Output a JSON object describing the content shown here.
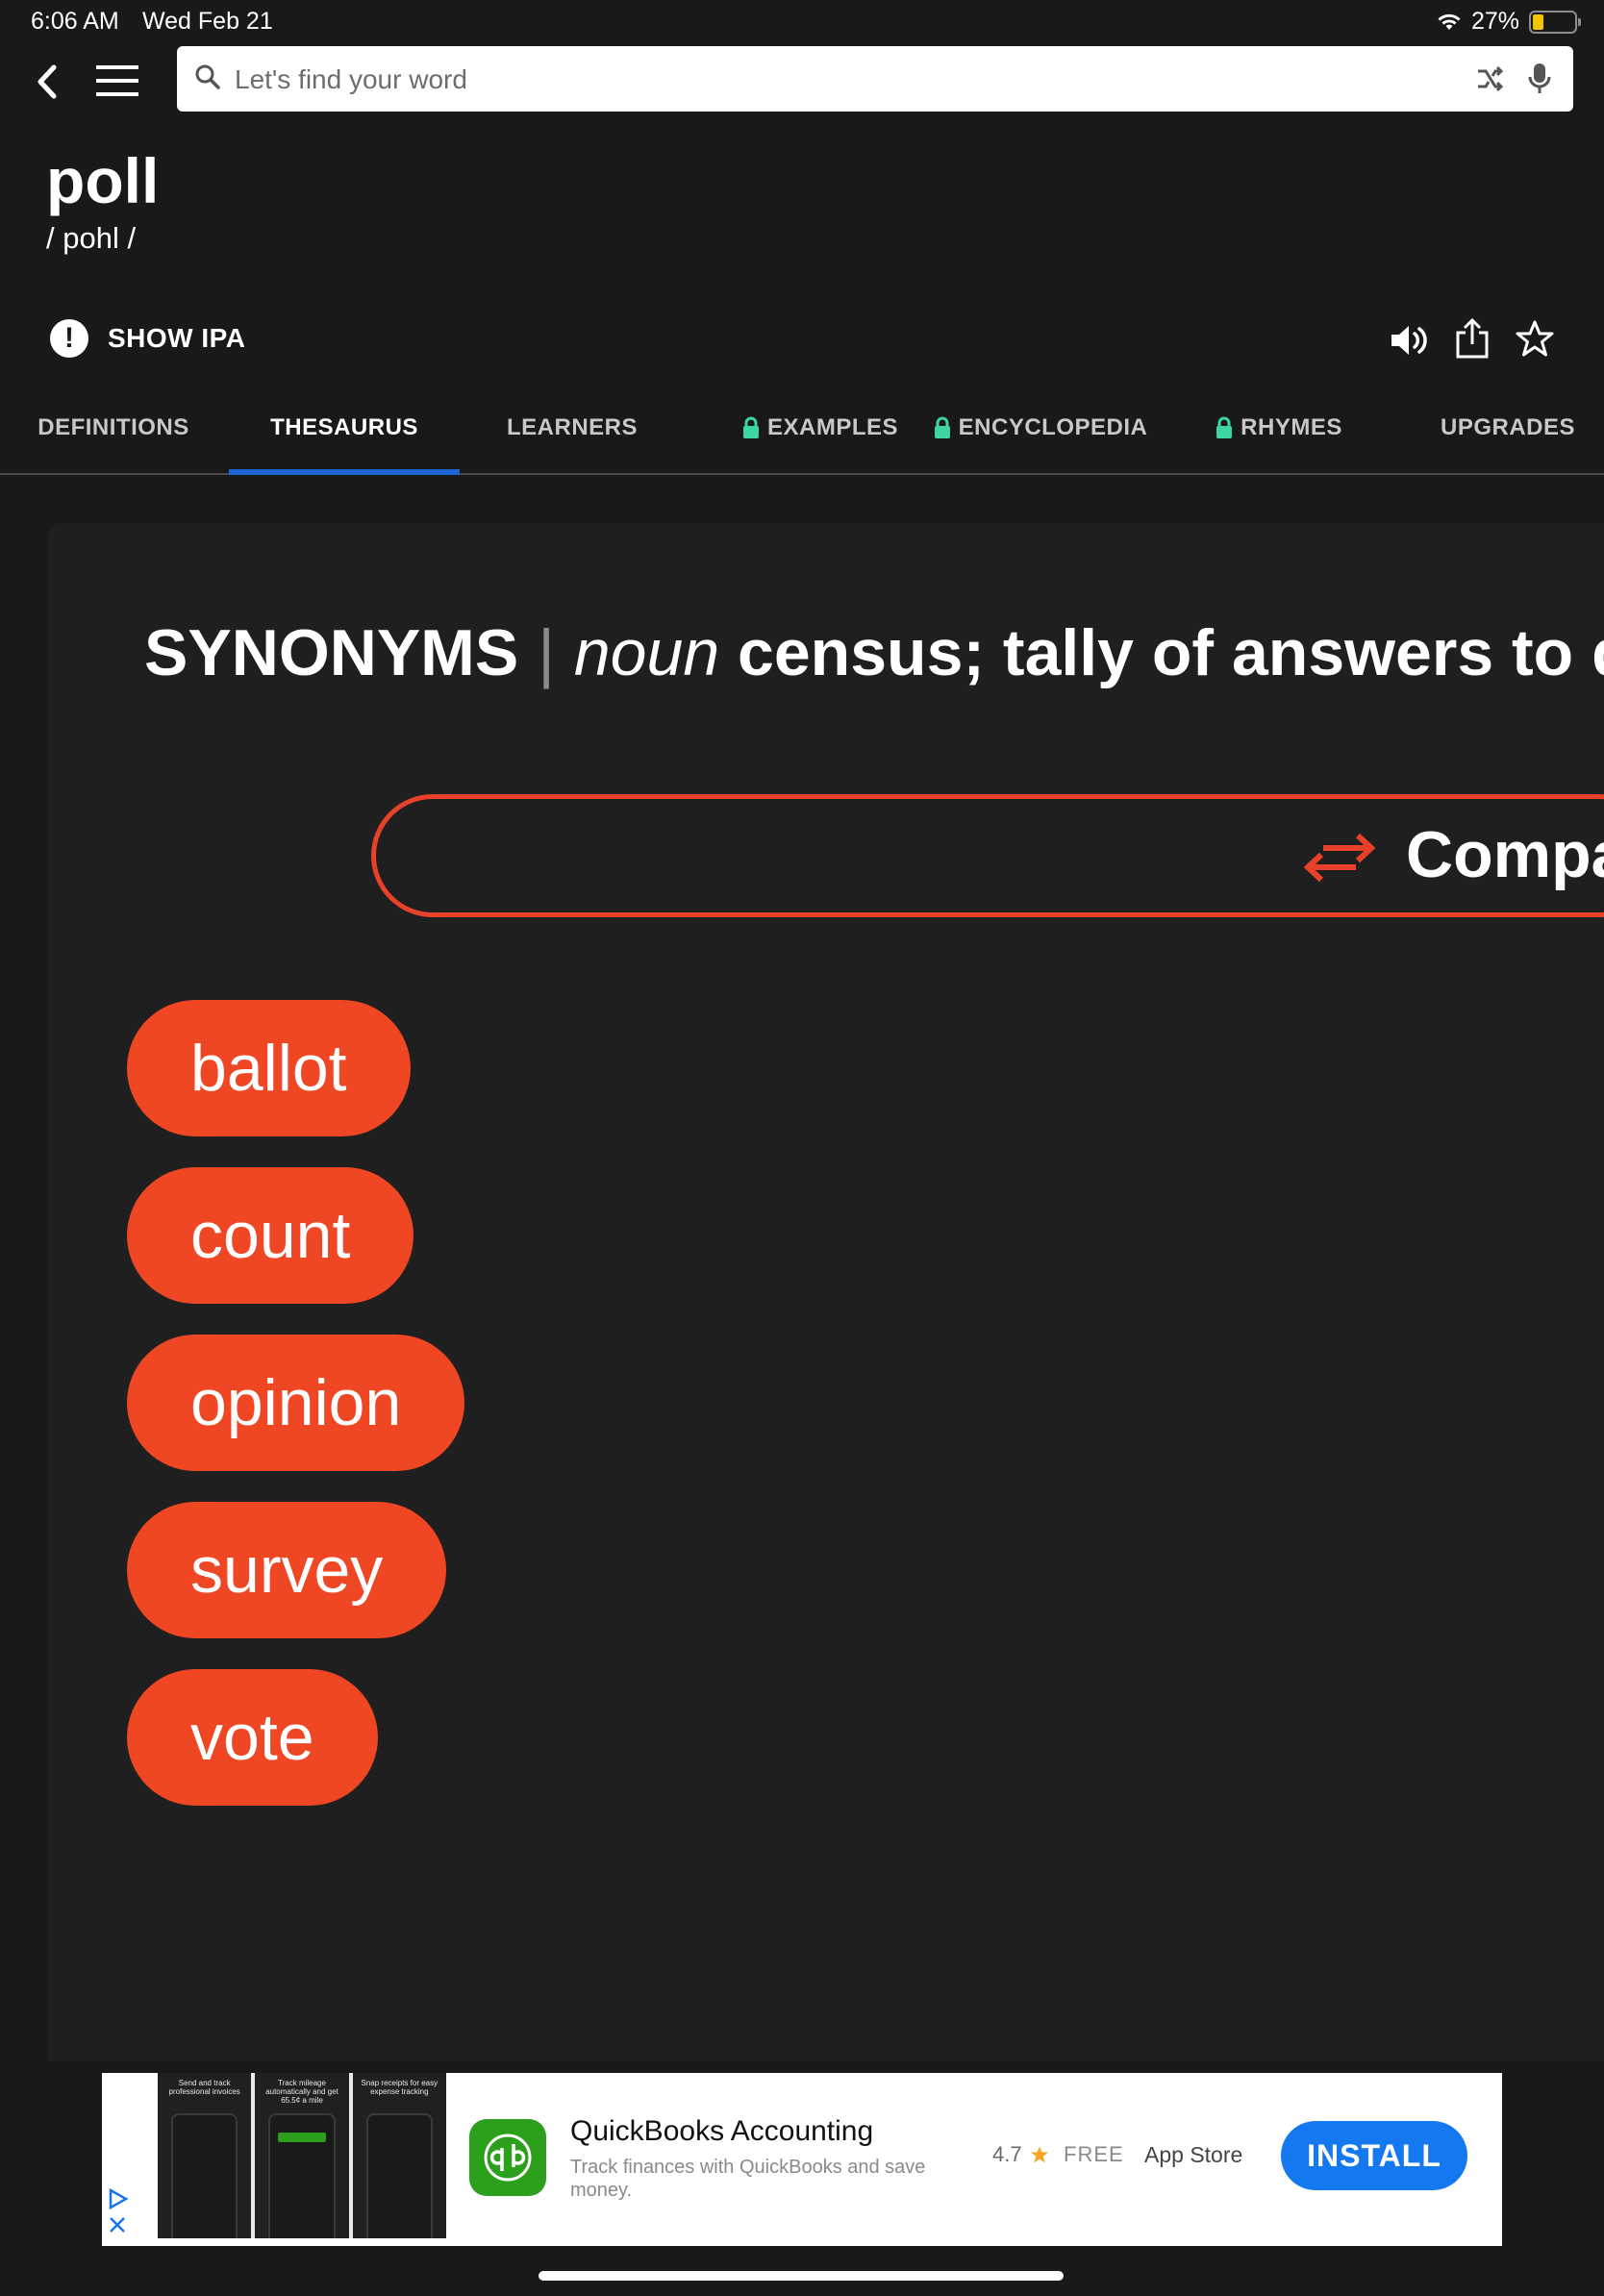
{
  "status_bar": {
    "time": "6:06 AM",
    "date": "Wed Feb 21",
    "battery": "27%",
    "battery_level": 0.27
  },
  "search": {
    "placeholder": "Let's find your word"
  },
  "entry": {
    "word": "poll",
    "pronunciation": "/ pohl  /",
    "show_ipa_label": "SHOW IPA"
  },
  "tabs": [
    {
      "label": "DEFINITIONS",
      "locked": false,
      "active": false
    },
    {
      "label": "THESAURUS",
      "locked": false,
      "active": true
    },
    {
      "label": "LEARNERS",
      "locked": false,
      "active": false
    },
    {
      "label": "EXAMPLES",
      "locked": true,
      "active": false
    },
    {
      "label": "ENCYCLOPEDIA",
      "locked": true,
      "active": false
    },
    {
      "label": "RHYMES",
      "locked": true,
      "active": false
    },
    {
      "label": "UPGRADES",
      "locked": false,
      "active": false
    }
  ],
  "synonyms": {
    "heading": "SYNONYMS",
    "separator": "|",
    "part_of_speech": "noun",
    "definition": "census; tally of answers to qu",
    "compare_label": "Compa",
    "words": [
      "ballot",
      "count",
      "opinion",
      "survey",
      "vote"
    ]
  },
  "ad": {
    "title": "QuickBooks Accounting",
    "description": "Track finances with QuickBooks and save money.",
    "rating": "4.7",
    "price": "FREE",
    "store": "App Store",
    "install_label": "INSTALL",
    "screenshots": [
      "Send and track professional invoices",
      "Track mileage automatically and get 65.5¢ a mile",
      "Snap receipts for easy expense tracking"
    ]
  },
  "colors": {
    "background": "#191919",
    "accent_red": "#ef4623",
    "tab_underline": "#1e64d2",
    "lock_green": "#3ed6a0",
    "install_blue": "#1478f0"
  }
}
